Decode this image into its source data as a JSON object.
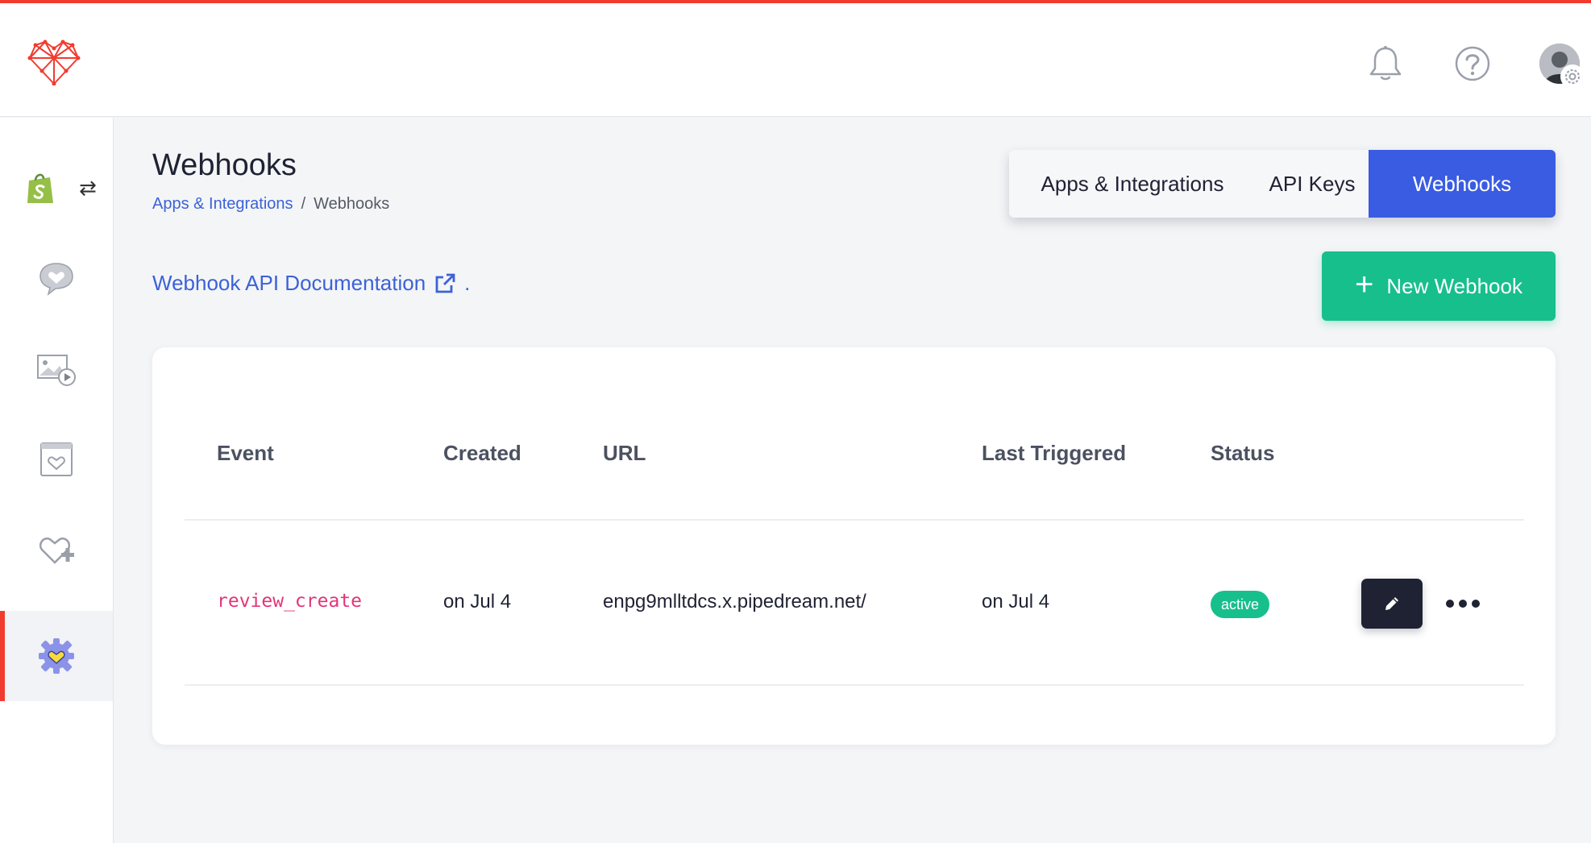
{
  "app": {
    "icons": {
      "logo": "heart-logo-icon",
      "bell": "bell-icon",
      "help": "help-icon",
      "avatar": "avatar",
      "avatar_gear": "gear-icon"
    },
    "accent_color": "#f23b2f"
  },
  "sidebar": {
    "items": [
      {
        "name": "shopify-icon",
        "swap_glyph": "⇄"
      },
      {
        "name": "reviews-icon"
      },
      {
        "name": "media-icon"
      },
      {
        "name": "widget-icon"
      },
      {
        "name": "add-heart-icon"
      },
      {
        "name": "settings-gear-icon",
        "active": true
      }
    ]
  },
  "header": {
    "title": "Webhooks",
    "breadcrumb": {
      "parent": "Apps & Integrations",
      "separator": "/",
      "current": "Webhooks"
    }
  },
  "tabs": [
    {
      "label": "Apps & Integrations",
      "active": false
    },
    {
      "label": "API Keys",
      "active": false
    },
    {
      "label": "Webhooks",
      "active": true,
      "color": "#3a5ce2"
    }
  ],
  "docs": {
    "label": "Webhook API Documentation",
    "suffix": "."
  },
  "actions": {
    "new_webhook": "New Webhook",
    "new_webhook_glyph": "+",
    "new_webhook_color": "#17bf8d"
  },
  "table": {
    "columns": [
      "Event",
      "Created",
      "URL",
      "Last Triggered",
      "Status"
    ],
    "rows": [
      {
        "event": "review_create",
        "created": "on Jul 4",
        "url": "enpg9mlltdcs.x.pipedream.net/",
        "last_triggered": "on Jul 4",
        "status": "active"
      }
    ]
  }
}
